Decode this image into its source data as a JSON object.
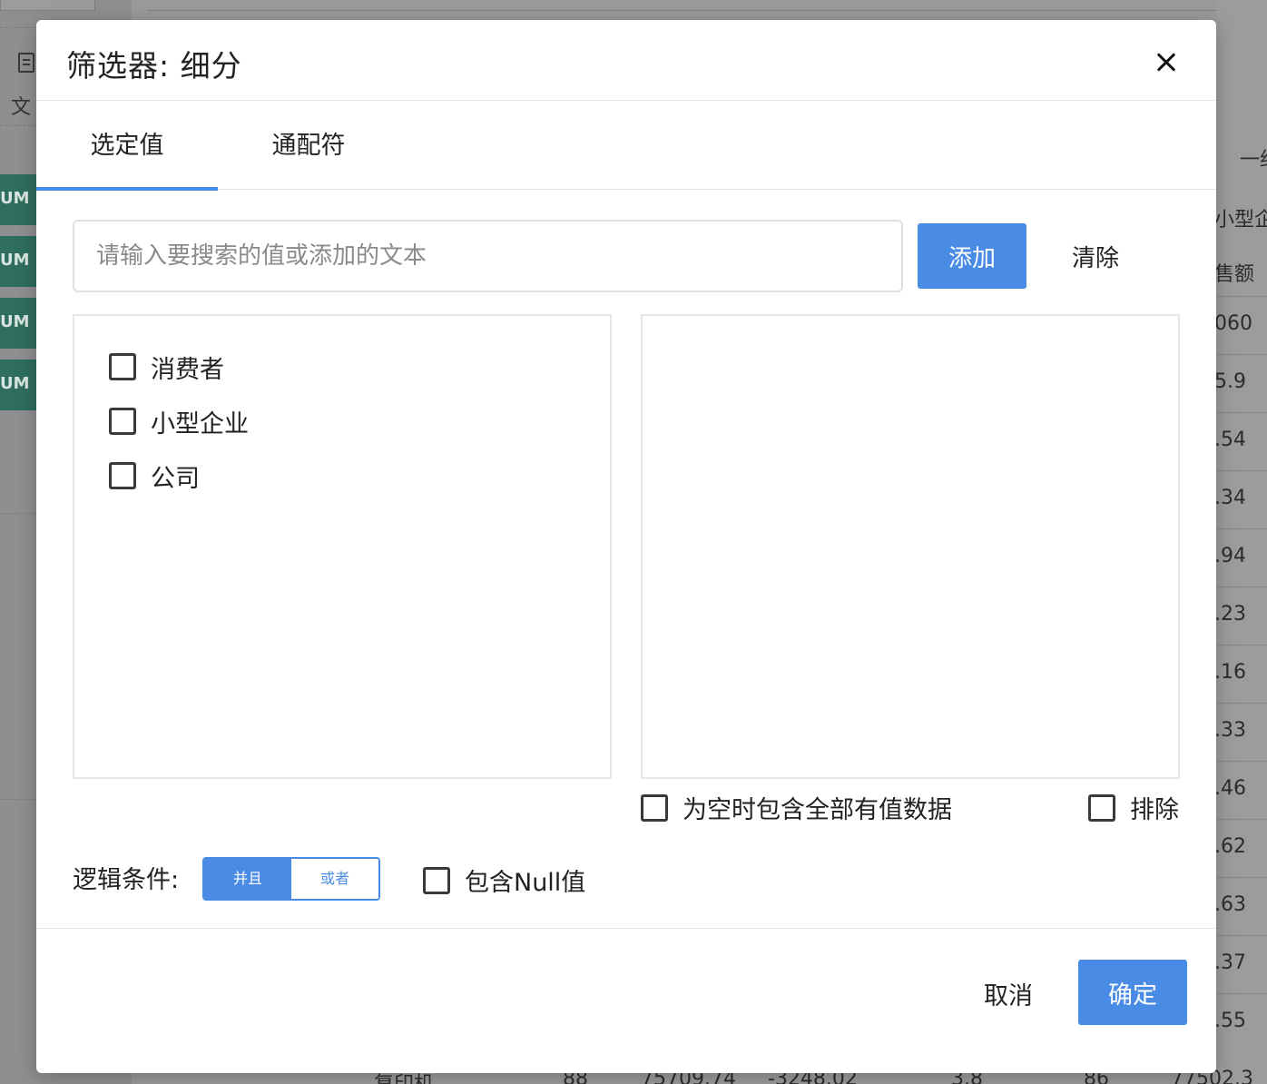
{
  "background": {
    "sidebar": {
      "doc_icon": "document-icon",
      "doc_label": "文",
      "pills": [
        "UM",
        "UM",
        "UM",
        "UM"
      ]
    },
    "right_column": {
      "header_partial": "一约",
      "segment_partial": "小型企",
      "metric_partial": "售额",
      "values": [
        "060",
        "5.9",
        ".54",
        ".34",
        ".94",
        ".23",
        ".16",
        ".33",
        ".46",
        ".62",
        ".63",
        ".37",
        ".55"
      ]
    },
    "bottom_row": [
      "复印机",
      "88",
      "75709.74",
      "-3248.02",
      "3.8",
      "86",
      "77502.3"
    ]
  },
  "dialog": {
    "title": "筛选器: 细分",
    "close_icon": "close-icon",
    "tabs": [
      {
        "label": "选定值",
        "active": true
      },
      {
        "label": "通配符",
        "active": false
      }
    ],
    "search": {
      "placeholder": "请输入要搜索的值或添加的文本",
      "value": ""
    },
    "add_label": "添加",
    "clear_label": "清除",
    "options": [
      {
        "label": "消费者",
        "checked": false
      },
      {
        "label": "小型企业",
        "checked": false
      },
      {
        "label": "公司",
        "checked": false
      }
    ],
    "include_all_when_empty": {
      "label": "为空时包含全部有值数据",
      "checked": false
    },
    "exclude": {
      "label": "排除",
      "checked": false
    },
    "logic": {
      "label": "逻辑条件:",
      "and_label": "并且",
      "or_label": "或者",
      "selected": "并且"
    },
    "include_null": {
      "label": "包含Null值",
      "checked": false
    },
    "cancel_label": "取消",
    "ok_label": "确定",
    "accent_color": "#4a8be6"
  }
}
